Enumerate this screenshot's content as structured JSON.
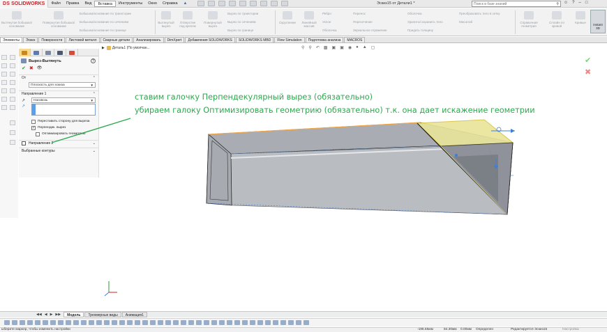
{
  "app": {
    "logo_ds": "DS",
    "logo_name": "SOLIDWORKS",
    "document_title": "Эскиз15 от Детали1 *"
  },
  "menu": [
    "Файл",
    "Правка",
    "Вид",
    "Вставка",
    "Инструменты",
    "Окно",
    "Справка"
  ],
  "menu_active_index": 3,
  "search": {
    "placeholder": "Поиск в базе знаний"
  },
  "ribbon": {
    "big_buttons": [
      "Вытянутая бобышка/основание",
      "Повернутая бобышка/основание",
      "Вытянутый вырез",
      "Отверстие под крепеж",
      "Повернутый вырез",
      "Скругление",
      "Линейный массив",
      "Справочная геометрия",
      "Сплайн по кривой",
      "Кривые",
      "Instant 3D"
    ],
    "small_buttons": [
      "Бобышка/основание по траектории",
      "Бобышка/основание по сечениям",
      "Бобышка/основание по границе",
      "Вырез по траектории",
      "Вырез по сечениям",
      "Вырез по границе",
      "Ребро",
      "Уклон",
      "Оболочка",
      "Перенос",
      "Пересечение",
      "Зеркальное отражение",
      "Оболочка",
      "Удалить/сохранить тело",
      "Придать толщину",
      "Преобразовать тело в сетку",
      "Масштаб",
      "Сделать маску"
    ]
  },
  "tabs": [
    "Элементы",
    "Эскиз",
    "Поверхности",
    "Листовой металл",
    "Сварные детали",
    "Анализировать",
    "DimXpert",
    "Добавления SOLIDWORKS",
    "SOLIDWORKS MBD",
    "Flow Simulation",
    "Подготовка анализа",
    "MACROS"
  ],
  "active_tab_index": 0,
  "property_manager": {
    "title": "Вырез-Вытянуть",
    "from_label": "От",
    "from_value": "Плоскость для эскиза",
    "direction1_label": "Направление 1",
    "direction1_value": "Насквозь",
    "flip_side_label": "Переставить сторону для выреза",
    "perpendicular_label": "Перпендик. вырез",
    "optimize_label": "Оптимизировать геометрию",
    "direction2_label": "Направление 2",
    "selected_contours_label": "Выбранные контуры",
    "perpendicular_checked": true,
    "optimize_checked": false,
    "flip_side_checked": false
  },
  "viewport": {
    "breadcrumb": "Деталь1 (По умолчан..."
  },
  "annotation": {
    "line1": "ставим галочку Перпендекулярный вырез (обязательно)",
    "line2": "убираем галоку Оптимизировать геометрию (обязательно) т.к. она дает искажение геометрии",
    "color": "#2fa84f"
  },
  "model_tabs": [
    "Модель",
    "Трехмерные виды",
    "Анимация1"
  ],
  "active_model_tab": 0,
  "status": {
    "hint": "ыберите маркер, чтобы изменить настройки",
    "coord_x": "-195.65мм",
    "coord_y": "84.30мм",
    "coord_z": "0.00мм",
    "state": "Определен",
    "editing": "Редактируется Эскиз15",
    "settings": "Настройка"
  },
  "colors": {
    "accent_orange": "#f0a64a",
    "tube_face": "#b7bac0",
    "yellow_face": "#e9e59a",
    "blue_handle": "#3b7fd8"
  }
}
